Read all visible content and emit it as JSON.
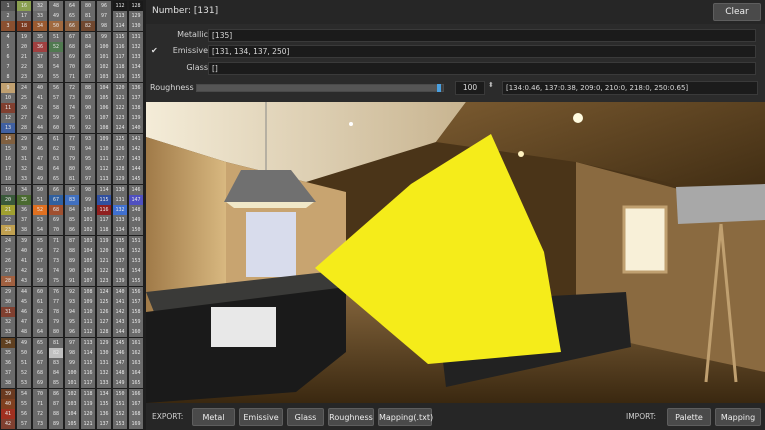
{
  "header": {
    "number_label": "Number: [131]",
    "clear_label": "Clear"
  },
  "properties": {
    "metallic": {
      "label": "Metallic",
      "value": "[135]",
      "checked": false
    },
    "emissive": {
      "label": "Emissive",
      "value": "[131, 134, 137, 250]",
      "checked": true,
      "check_glyph": "✔"
    },
    "glass": {
      "label": "Glass",
      "value": "[]",
      "checked": false
    }
  },
  "roughness": {
    "label": "Roughness",
    "slider_fraction": 0.99,
    "value": "100",
    "spin_glyph": "⬍",
    "mapping": "[134:0.46, 137:0.38, 209:0, 210:0, 218:0, 250:0.65]"
  },
  "export": {
    "label": "EXPORT:",
    "buttons": [
      "Metal",
      "Emissive",
      "Glass",
      "Roughness",
      "Mapping(.txt)"
    ]
  },
  "import": {
    "label": "IMPORT:",
    "buttons": [
      "Palette",
      "Mapping"
    ]
  },
  "colors": {
    "accent": "#4aa0e0",
    "highlight_yellow": "#f5ec1a",
    "orange_cell": "#e07020"
  },
  "palette": {
    "rows": [
      [
        "1",
        "16",
        "32",
        "48",
        "64",
        "80",
        "96",
        "112",
        "128"
      ],
      [
        "2",
        "17",
        "33",
        "49",
        "65",
        "81",
        "97",
        "113",
        "129"
      ],
      [
        "3",
        "18",
        "34",
        "50",
        "66",
        "82",
        "98",
        "114",
        "130"
      ],
      [
        "4",
        "19",
        "35",
        "51",
        "67",
        "83",
        "99",
        "115",
        "131"
      ],
      [
        "5",
        "20",
        "36",
        "52",
        "68",
        "84",
        "100",
        "116",
        "132"
      ],
      [
        "6",
        "21",
        "37",
        "53",
        "69",
        "85",
        "101",
        "117",
        "133"
      ],
      [
        "7",
        "22",
        "38",
        "54",
        "70",
        "86",
        "102",
        "118",
        "134"
      ],
      [
        "8",
        "23",
        "39",
        "55",
        "71",
        "87",
        "103",
        "119",
        "135"
      ],
      [
        "9",
        "24",
        "40",
        "56",
        "72",
        "88",
        "104",
        "120",
        "136"
      ],
      [
        "10",
        "25",
        "41",
        "57",
        "73",
        "89",
        "105",
        "121",
        "137"
      ],
      [
        "11",
        "26",
        "42",
        "58",
        "74",
        "90",
        "106",
        "122",
        "138"
      ],
      [
        "12",
        "27",
        "43",
        "59",
        "75",
        "91",
        "107",
        "123",
        "139"
      ],
      [
        "13",
        "28",
        "44",
        "60",
        "76",
        "92",
        "108",
        "124",
        "140"
      ],
      [
        "14",
        "29",
        "45",
        "61",
        "77",
        "93",
        "109",
        "125",
        "141"
      ],
      [
        "15",
        "30",
        "46",
        "62",
        "78",
        "94",
        "110",
        "126",
        "142"
      ],
      [
        "16",
        "31",
        "47",
        "63",
        "79",
        "95",
        "111",
        "127",
        "143"
      ],
      [
        "17",
        "32",
        "48",
        "64",
        "80",
        "96",
        "112",
        "128",
        "144"
      ],
      [
        "18",
        "33",
        "49",
        "65",
        "81",
        "97",
        "113",
        "129",
        "145"
      ],
      [
        "19",
        "34",
        "50",
        "66",
        "82",
        "98",
        "114",
        "130",
        "146"
      ],
      [
        "20",
        "35",
        "51",
        "67",
        "83",
        "99",
        "115",
        "131",
        "147"
      ],
      [
        "21",
        "36",
        "52",
        "68",
        "84",
        "100",
        "116",
        "132",
        "148"
      ],
      [
        "22",
        "37",
        "53",
        "69",
        "85",
        "101",
        "117",
        "133",
        "149"
      ],
      [
        "23",
        "38",
        "54",
        "70",
        "86",
        "102",
        "118",
        "134",
        "150"
      ],
      [
        "24",
        "39",
        "55",
        "71",
        "87",
        "103",
        "119",
        "135",
        "151"
      ],
      [
        "25",
        "40",
        "56",
        "72",
        "88",
        "104",
        "120",
        "136",
        "152"
      ],
      [
        "26",
        "41",
        "57",
        "73",
        "89",
        "105",
        "121",
        "137",
        "153"
      ],
      [
        "27",
        "42",
        "58",
        "74",
        "90",
        "106",
        "122",
        "138",
        "154"
      ],
      [
        "28",
        "43",
        "59",
        "75",
        "91",
        "107",
        "123",
        "139",
        "155"
      ],
      [
        "29",
        "44",
        "60",
        "76",
        "92",
        "108",
        "124",
        "140",
        "156"
      ],
      [
        "30",
        "45",
        "61",
        "77",
        "93",
        "109",
        "125",
        "141",
        "157"
      ],
      [
        "31",
        "46",
        "62",
        "78",
        "94",
        "110",
        "126",
        "142",
        "158"
      ],
      [
        "32",
        "47",
        "63",
        "79",
        "95",
        "111",
        "127",
        "143",
        "159"
      ],
      [
        "33",
        "48",
        "64",
        "80",
        "96",
        "112",
        "128",
        "144",
        "160"
      ],
      [
        "34",
        "49",
        "65",
        "81",
        "97",
        "113",
        "129",
        "145",
        "161"
      ],
      [
        "35",
        "50",
        "66",
        "82",
        "98",
        "114",
        "130",
        "146",
        "162"
      ],
      [
        "36",
        "51",
        "67",
        "83",
        "99",
        "115",
        "131",
        "147",
        "163"
      ],
      [
        "37",
        "52",
        "68",
        "84",
        "100",
        "116",
        "132",
        "148",
        "164"
      ],
      [
        "38",
        "53",
        "69",
        "85",
        "101",
        "117",
        "133",
        "149",
        "165"
      ],
      [
        "39",
        "54",
        "70",
        "86",
        "102",
        "118",
        "134",
        "150",
        "166"
      ],
      [
        "40",
        "55",
        "71",
        "87",
        "103",
        "119",
        "135",
        "151",
        "167"
      ],
      [
        "41",
        "56",
        "72",
        "88",
        "104",
        "120",
        "136",
        "152",
        "168"
      ],
      [
        "42",
        "57",
        "73",
        "89",
        "105",
        "121",
        "137",
        "153",
        "169"
      ]
    ],
    "colors": {
      "0-0": "#555",
      "0-1": "#8aa050",
      "0-2": "#7a7a7a",
      "0-7": "#1a1a1a",
      "0-8": "#1a1a1a",
      "2-0": "#8a5030",
      "2-1": "#7a3a20",
      "2-2": "#9a5a30",
      "2-3": "#a06a40",
      "2-4": "#8a6040",
      "2-5": "#704830",
      "4-3": "#507a50",
      "4-2": "#a04040",
      "8-0": "#c0a070",
      "10-0": "#804030",
      "12-0": "#4060a0",
      "13-0": "#806040",
      "19-0": "#3a5a3a",
      "19-1": "#4a6a30",
      "19-3": "#3060a0",
      "19-4": "#4070c0",
      "19-6": "#3050a0",
      "19-8": "#5050c0",
      "20-0": "#a0a030",
      "20-2": "#e07020",
      "20-3": "#a05030",
      "20-6": "#902020",
      "20-7": "#4070d0",
      "22-0": "#c0a050",
      "27-0": "#a06040",
      "30-0": "#804030",
      "33-0": "#604020",
      "34-3": "#c0c0c0",
      "38-0": "#6a3a20",
      "39-0": "#804020",
      "40-0": "#a03020",
      "41-0": "#804030"
    }
  }
}
